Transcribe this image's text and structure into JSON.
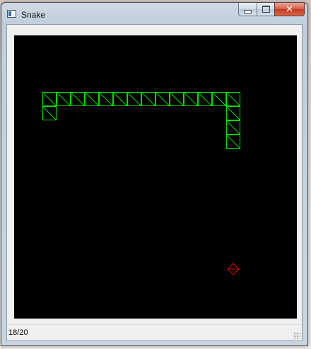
{
  "window": {
    "title": "Snake"
  },
  "titlebar": {
    "close_glyph": "✕"
  },
  "status": {
    "score": "18/20"
  },
  "game": {
    "grid_cols": 20,
    "grid_rows": 20,
    "snake_color": "#00dd00",
    "food_color": "#dd0000",
    "board_color": "#000000",
    "snake_cells": [
      [
        2,
        4
      ],
      [
        3,
        4
      ],
      [
        4,
        4
      ],
      [
        5,
        4
      ],
      [
        6,
        4
      ],
      [
        7,
        4
      ],
      [
        8,
        4
      ],
      [
        9,
        4
      ],
      [
        10,
        4
      ],
      [
        11,
        4
      ],
      [
        12,
        4
      ],
      [
        13,
        4
      ],
      [
        14,
        4
      ],
      [
        15,
        4
      ],
      [
        2,
        5
      ],
      [
        15,
        5
      ],
      [
        15,
        6
      ],
      [
        15,
        7
      ]
    ],
    "food_cell": [
      15,
      16
    ]
  }
}
